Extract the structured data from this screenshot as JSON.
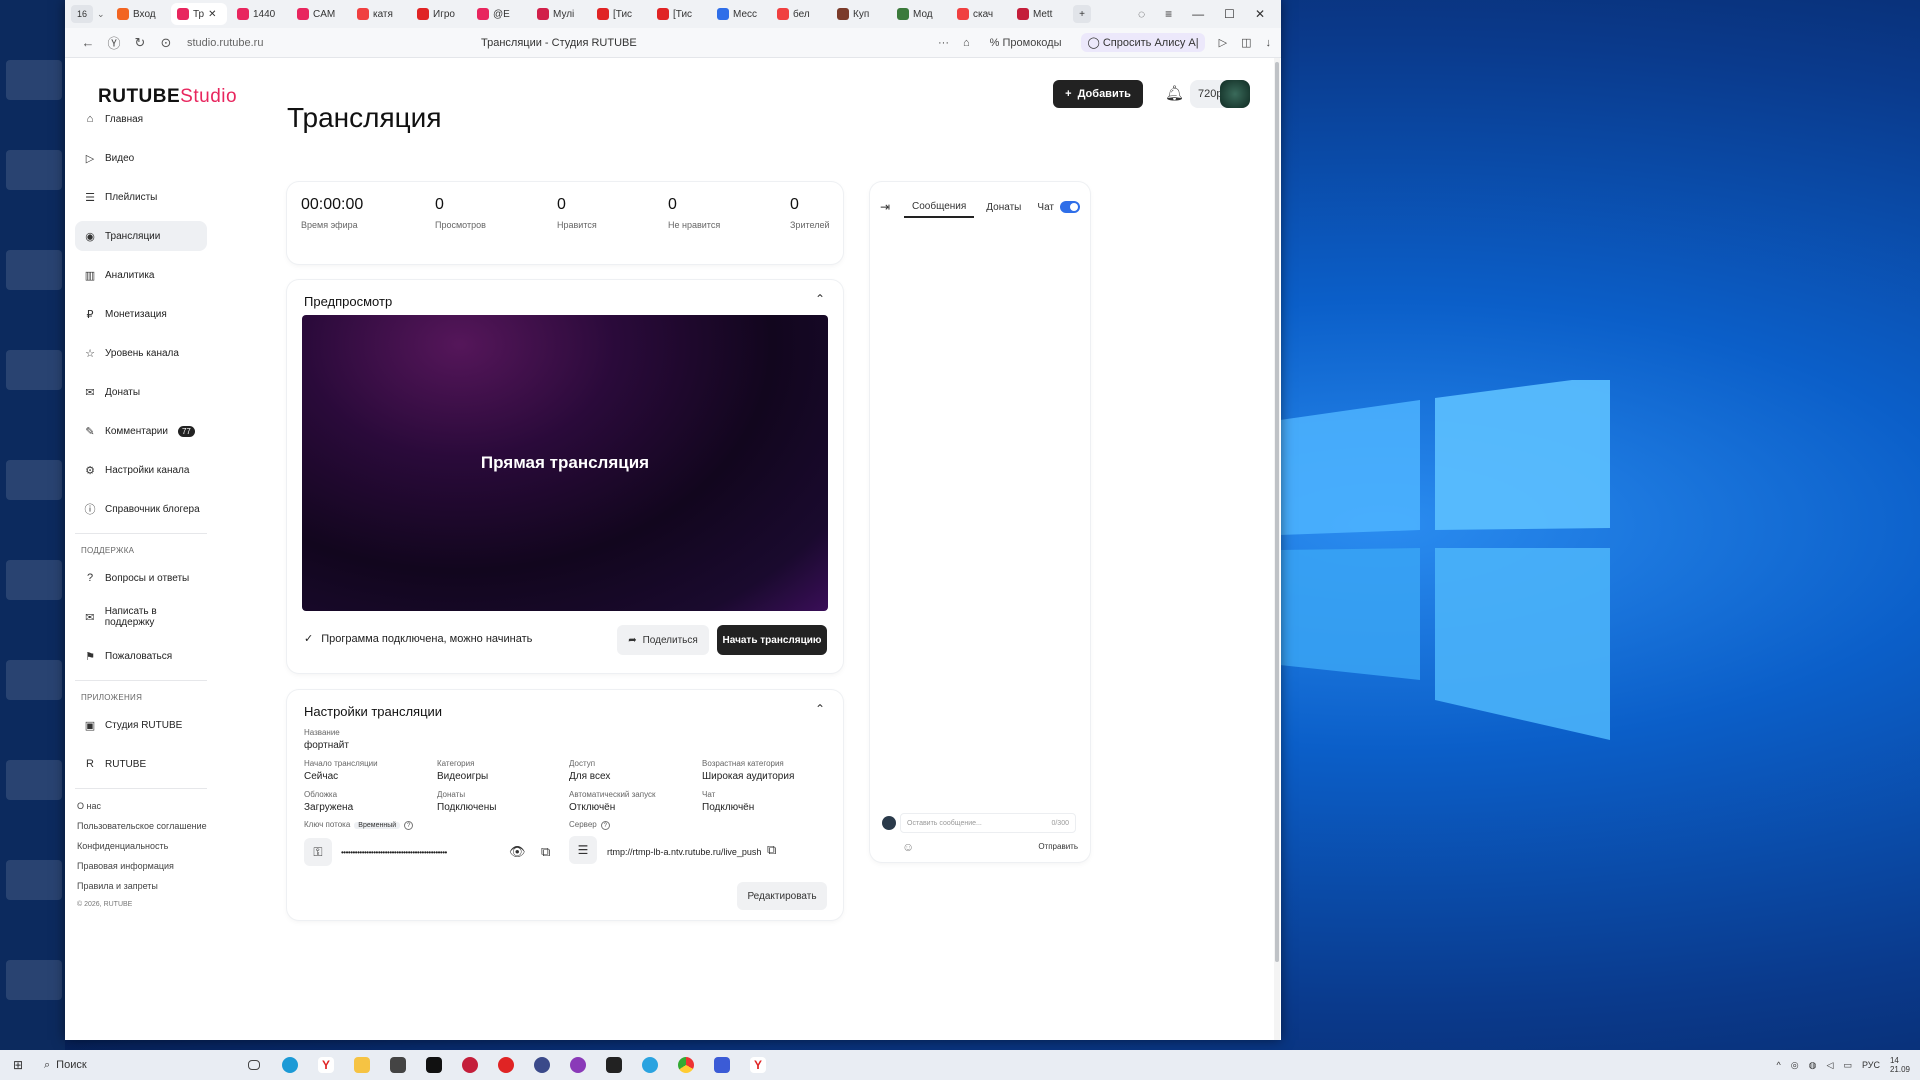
{
  "browser": {
    "tab_count": "16",
    "tabs": [
      {
        "label": "Вход",
        "color": "#f26522"
      },
      {
        "label": "Тр",
        "color": "#e8265e",
        "active": true
      },
      {
        "label": "1440",
        "color": "#e8265e"
      },
      {
        "label": "CAM",
        "color": "#e8265e"
      },
      {
        "label": "катя",
        "color": "#f04040"
      },
      {
        "label": "Игро",
        "color": "#e02424"
      },
      {
        "label": "@Е",
        "color": "#e8265e"
      },
      {
        "label": "Мулі",
        "color": "#d1204a"
      },
      {
        "label": "[Тис",
        "color": "#e02424"
      },
      {
        "label": "[Тис",
        "color": "#e02424"
      },
      {
        "label": "Месс",
        "color": "#2f6ee8"
      },
      {
        "label": "бел",
        "color": "#f04040"
      },
      {
        "label": "Куп",
        "color": "#7b3b2a"
      },
      {
        "label": "Мод",
        "color": "#3b7a3b"
      },
      {
        "label": "скач",
        "color": "#f04040"
      },
      {
        "label": "Mett",
        "color": "#c41e3a"
      }
    ],
    "url": "studio.rutube.ru",
    "page_title": "Трансляции - Студия RUTUBE",
    "promo_label": "Промокоды",
    "alisa_label": "Спросить Алису А|"
  },
  "app": {
    "logo_main": "RUTUBE",
    "logo_studio": "Studio",
    "add_button": "Добавить",
    "quality": "720p"
  },
  "sidebar": {
    "items": [
      {
        "label": "Главная",
        "icon": "home-icon",
        "glyph": "⌂"
      },
      {
        "label": "Видео",
        "icon": "video-icon",
        "glyph": "▷"
      },
      {
        "label": "Плейлисты",
        "icon": "playlist-icon",
        "glyph": "☰"
      },
      {
        "label": "Трансляции",
        "icon": "broadcast-icon",
        "glyph": "◉",
        "active": true
      },
      {
        "label": "Аналитика",
        "icon": "analytics-icon",
        "glyph": "▥"
      },
      {
        "label": "Монетизация",
        "icon": "monetization-icon",
        "glyph": "₽"
      },
      {
        "label": "Уровень канала",
        "icon": "star-icon",
        "glyph": "☆"
      },
      {
        "label": "Донаты",
        "icon": "donate-icon",
        "glyph": "✉"
      },
      {
        "label": "Комментарии",
        "icon": "comment-icon",
        "glyph": "✎",
        "badge": "77"
      },
      {
        "label": "Настройки канала",
        "icon": "gear-icon",
        "glyph": "⚙"
      },
      {
        "label": "Справочник блогера",
        "icon": "info-icon",
        "glyph": "ⓘ"
      }
    ],
    "support_title": "ПОДДЕРЖКА",
    "support_items": [
      {
        "label": "Вопросы и ответы",
        "icon": "question-icon",
        "glyph": "?"
      },
      {
        "label": "Написать в поддержку",
        "icon": "mail-icon",
        "glyph": "✉"
      },
      {
        "label": "Пожаловаться",
        "icon": "flag-icon",
        "glyph": "⚑"
      }
    ],
    "apps_title": "ПРИЛОЖЕНИЯ",
    "apps_items": [
      {
        "label": "Студия RUTUBE",
        "icon": "studio-app-icon",
        "glyph": "▣"
      },
      {
        "label": "RUTUBE",
        "icon": "rutube-app-icon",
        "glyph": "R"
      }
    ],
    "footer_links": [
      "О нас",
      "Пользовательское соглашение",
      "Конфиденциальность",
      "Правовая информация",
      "Правила и запреты"
    ],
    "copyright": "© 2026, RUTUBE"
  },
  "main": {
    "title": "Трансляция",
    "stats": [
      {
        "value": "00:00:00",
        "label": "Время эфира"
      },
      {
        "value": "0",
        "label": "Просмотров"
      },
      {
        "value": "0",
        "label": "Нравится"
      },
      {
        "value": "0",
        "label": "Не нравится"
      },
      {
        "value": "0",
        "label": "Зрителей"
      }
    ],
    "preview": {
      "title": "Предпросмотр",
      "video_text": "Прямая трансляция",
      "status": "Программа подключена, можно начинать",
      "share": "Поделиться",
      "start": "Начать трансляцию"
    },
    "settings": {
      "title": "Настройки трансляции",
      "name_label": "Название",
      "name_value": "фортнайт",
      "fields": [
        {
          "label": "Начало трансляции",
          "value": "Сейчас"
        },
        {
          "label": "Категория",
          "value": "Видеоигры"
        },
        {
          "label": "Доступ",
          "value": "Для всех"
        },
        {
          "label": "Возрастная категория",
          "value": "Широкая аудитория"
        },
        {
          "label": "Обложка",
          "value": "Загружена"
        },
        {
          "label": "Донаты",
          "value": "Подключены"
        },
        {
          "label": "Автоматический запуск",
          "value": "Отключён"
        },
        {
          "label": "Чат",
          "value": "Подключён"
        }
      ],
      "key_label": "Ключ потока",
      "key_badge": "Временный",
      "key_value": "••••••••••••••••••••••••••••••••••••••••••••••",
      "server_label": "Сервер",
      "server_value": "rtmp://rtmp-lb-a.ntv.rutube.ru/live_push",
      "edit_button": "Редактировать"
    }
  },
  "chat": {
    "tab_messages": "Сообщения",
    "tab_donates": "Донаты",
    "chat_toggle_label": "Чат",
    "input_placeholder": "Оставить сообщение...",
    "counter": "0/300",
    "send": "Отправить"
  },
  "taskbar": {
    "search": "Поиск",
    "lang": "РУС",
    "time": "14",
    "date": "21.09"
  },
  "colors": {
    "accent": "#e8265e",
    "toggle": "#2f6ee8",
    "dark_button": "#222222"
  }
}
